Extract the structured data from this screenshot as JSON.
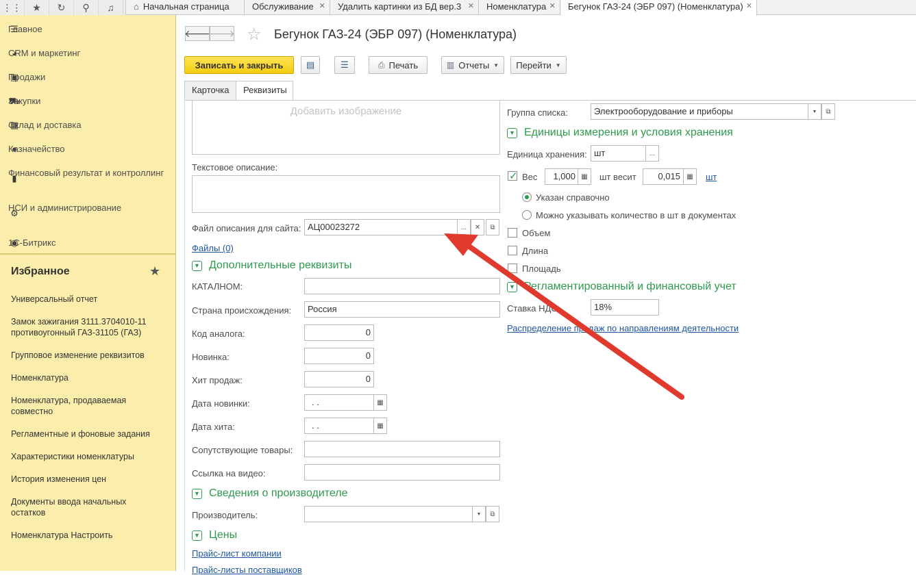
{
  "tabs": [
    {
      "label": "Начальная страница",
      "icon": "home-icon"
    },
    {
      "label": "Обслуживание"
    },
    {
      "label": "Удалить картинки из БД  вер.3"
    },
    {
      "label": "Номенклатура"
    },
    {
      "label": "Бегунок ГАЗ-24 (ЭБР 097) (Номенклатура)"
    }
  ],
  "sections": [
    {
      "label": "Главное",
      "icon": "menu-icon"
    },
    {
      "label": "CRM и маркетинг",
      "icon": "pie-chart-icon"
    },
    {
      "label": "Продажи",
      "icon": "bag-icon"
    },
    {
      "label": "Закупки",
      "icon": "cart-icon"
    },
    {
      "label": "Склад и доставка",
      "icon": "grid-icon"
    },
    {
      "label": "Казначейство",
      "icon": "coin-icon"
    },
    {
      "label": "Финансовый результат и контроллинг",
      "icon": "bar-chart-icon"
    },
    {
      "label": "НСИ и администрирование",
      "icon": "gear-icon"
    },
    {
      "label": "1С-Битрикс",
      "icon": "bitrix-icon"
    }
  ],
  "favorites": {
    "title": "Избранное",
    "items": [
      "Универсальный отчет",
      "Замок зажигания 3111.3704010-11 противоугонный ГАЗ-31105 (ГАЗ)",
      "Групповое изменение реквизитов",
      "Номенклатура",
      "Номенклатура, продаваемая совместно",
      "Регламентные и фоновые задания",
      "Характеристики номенклатуры",
      "История изменения цен",
      "Документы ввода начальных остатков",
      "Номенклатура Настроить"
    ]
  },
  "doc": {
    "title": "Бегунок ГАЗ-24 (ЭБР 097) (Номенклатура)"
  },
  "toolbar": {
    "save_close": "Записать и закрыть",
    "print": "Печать",
    "reports": "Отчеты",
    "goto": "Перейти"
  },
  "form_tabs": [
    "Карточка",
    "Реквизиты"
  ],
  "left": {
    "image_placeholder": "Добавить изображение",
    "text_desc_label": "Текстовое описание:",
    "site_file_label": "Файл описания для сайта:",
    "site_file_value": "АЦ00023272",
    "files_link": "Файлы (0)",
    "extra_group": "Дополнительные реквизиты",
    "fields": [
      {
        "label": "КАТАЛНОМ:",
        "value": ""
      },
      {
        "label": "Страна происхождения:",
        "value": "Россия"
      },
      {
        "label": "Код аналога:",
        "value": "0"
      },
      {
        "label": "Новинка:",
        "value": "0"
      },
      {
        "label": "Хит продаж:",
        "value": "0"
      },
      {
        "label": "Дата новинки:",
        "value": " .  ."
      },
      {
        "label": "Дата хита:",
        "value": " .  ."
      },
      {
        "label": "Сопутствующие товары:",
        "value": ""
      },
      {
        "label": "Ссылка на видео:",
        "value": ""
      }
    ],
    "manufacturer_group": "Сведения о производителе",
    "manufacturer_label": "Производитель:",
    "manufacturer_value": "",
    "prices_group": "Цены",
    "price_link_1": "Прайс-лист компании",
    "price_link_2": "Прайс-листы поставщиков"
  },
  "right": {
    "list_group_label": "Группа списка:",
    "list_group_value": "Электрооборудование и приборы",
    "units_group": "Единицы измерения и условия хранения",
    "storage_unit_label": "Единица хранения:",
    "storage_unit_value": "шт",
    "weight_label": "Вес",
    "weight_checked": true,
    "weight_value": "1,000",
    "weight_mid_text": "шт весит",
    "weight_per_unit": "0,015",
    "weight_unit_link": "шт",
    "radio_1": "Указан справочно",
    "radio_2": "Можно указывать количество в шт в документах",
    "volume_label": "Объем",
    "length_label": "Длина",
    "area_label": "Площадь",
    "accounting_group": "Регламентированный и финансовый учет",
    "vat_label": "Ставка НДС:",
    "vat_value": "18%",
    "distribution_link": "Распределение продаж по направлениям деятельности"
  },
  "colors": {
    "accent_green": "#2e9a4e",
    "sidebar_bg": "#fbeeac",
    "primary_button": "#f5cd0f",
    "link": "#1e57a3",
    "annotation_arrow": "#e03a2f"
  }
}
